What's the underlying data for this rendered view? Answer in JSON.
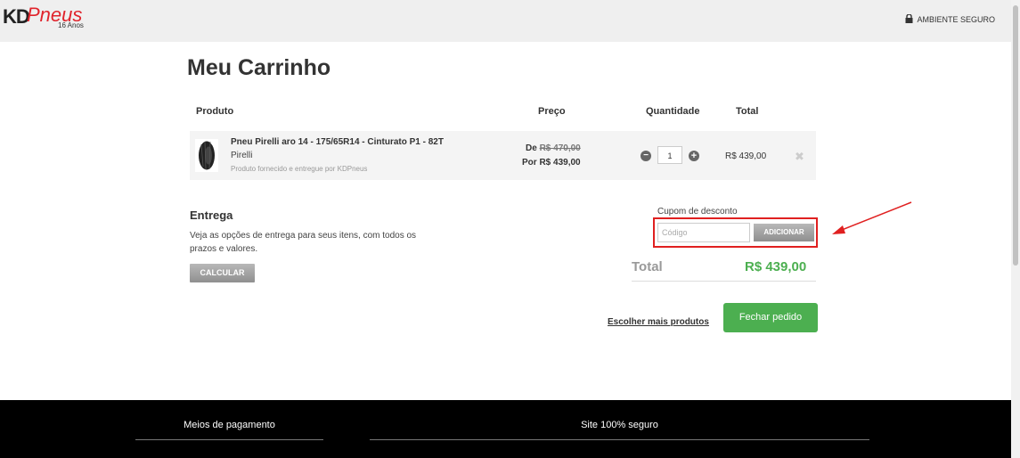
{
  "header": {
    "logo_kd": "KD",
    "logo_pneus": "Pneus",
    "logo_anos": "16 Anos",
    "secure_label": "AMBIENTE SEGURO"
  },
  "page": {
    "title": "Meu Carrinho"
  },
  "table": {
    "headers": [
      "Produto",
      "Preço",
      "Quantidade",
      "Total"
    ]
  },
  "item": {
    "name": "Pneu Pirelli aro 14 - 175/65R14 - Cinturato P1 - 82T",
    "brand": "Pirelli",
    "note": "Produto fornecido e entregue por KDPneus",
    "price_old_prefix": "De",
    "price_old": "R$ 470,00",
    "price_new": "Por R$ 439,00",
    "quantity": "1",
    "line_total": "R$ 439,00"
  },
  "entrega": {
    "title": "Entrega",
    "text": "Veja as opções de entrega para seus itens, com todos os prazos e valores.",
    "button": "CALCULAR"
  },
  "cupom": {
    "label": "Cupom de desconto",
    "placeholder": "Código",
    "button": "ADICIONAR"
  },
  "summary": {
    "total_label": "Total",
    "total_value": "R$ 439,00"
  },
  "actions": {
    "more_products": "Escolher mais produtos",
    "checkout": "Fechar pedido"
  },
  "footer": {
    "payment": "Meios de pagamento",
    "secure": "Site 100% seguro"
  },
  "colors": {
    "accent_green": "#4caf50",
    "brand_red": "#e0242c",
    "highlight_red": "#e02020"
  }
}
